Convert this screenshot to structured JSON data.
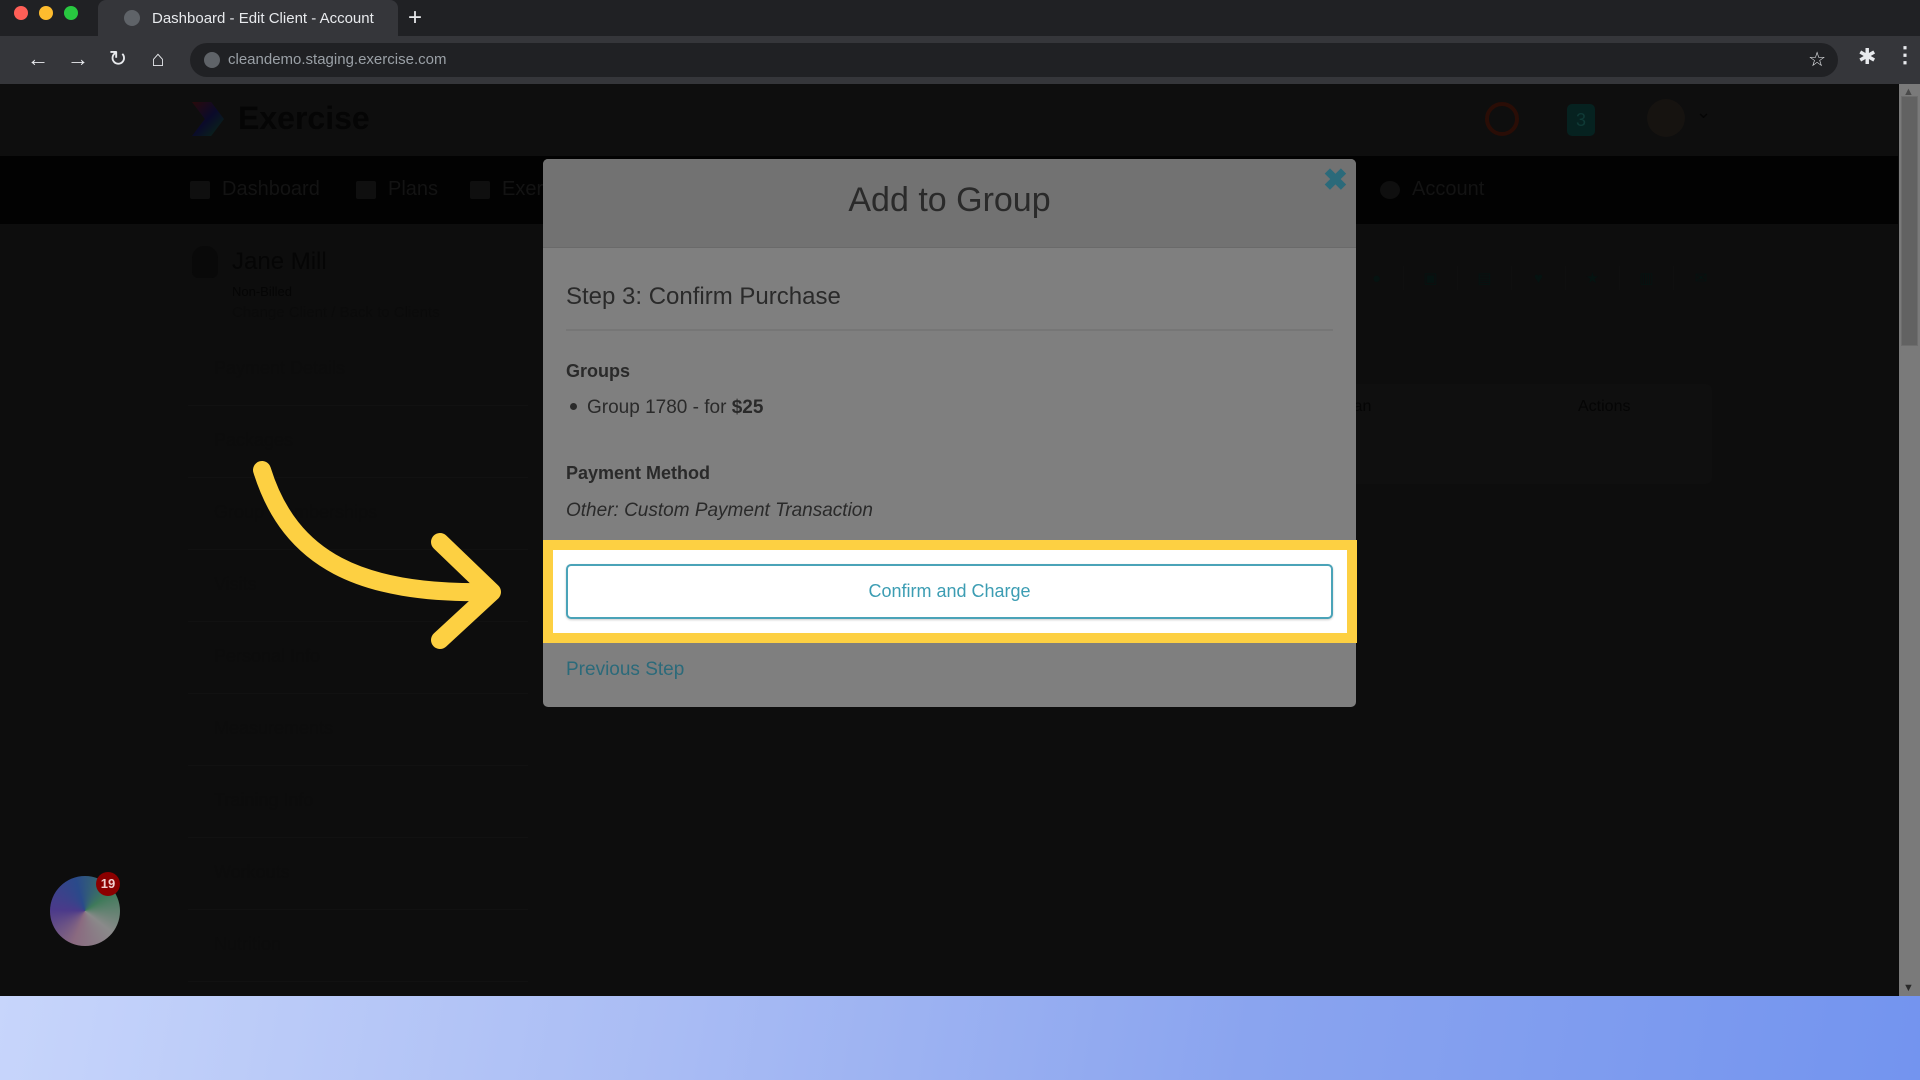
{
  "browser": {
    "tab_title": "Dashboard - Edit Client - Account",
    "new_tab_icon": "+",
    "url": "cleandemo.staging.exercise.com",
    "icons": {
      "back": "←",
      "forward": "→",
      "reload": "↻",
      "home": "⌂",
      "star": "☆",
      "extensions": "✱",
      "menu": "⋮"
    }
  },
  "app": {
    "logo_text": "Exercise",
    "header_badge": "3",
    "header_chevron": "⌄",
    "nav": [
      {
        "label": "Dashboard",
        "icon": "list-icon"
      },
      {
        "label": "Plans",
        "icon": "clipboard-icon"
      },
      {
        "label": "Exer",
        "icon": "dumbbell-icon"
      },
      {
        "label": "Account",
        "icon": "user-circle-icon"
      }
    ],
    "client": {
      "name": "Jane Mill",
      "status": "Non-Billed",
      "links": "Change Client / Back to Clients"
    },
    "side_menu": [
      "Payment Details",
      "Packages",
      "Group Memberships",
      "Visits",
      "Personal Info",
      "Measurements",
      "Training Info",
      "Workouts",
      "Nutrition"
    ],
    "icon_row": [
      "user-icon",
      "calendar-check-icon",
      "document-icon",
      "heartbeat-icon",
      "star-icon",
      "bar-chart-icon",
      "envelope-icon"
    ],
    "icon_row_glyphs": [
      "●",
      "▣",
      "▤",
      "♥",
      "★",
      "▥",
      "✉"
    ],
    "table_headers": {
      "plan": "lan",
      "actions": "Actions"
    }
  },
  "assistant": {
    "badge_count": "19"
  },
  "modal": {
    "title": "Add to Group",
    "close_icon": "✖",
    "step_title": "Step 3: Confirm Purchase",
    "groups_heading": "Groups",
    "group_item_text": "Group 1780 - for ",
    "group_item_price": "$25",
    "payment_heading": "Payment Method",
    "payment_value": "Other: Custom Payment Transaction",
    "confirm_label": "Confirm and Charge",
    "previous_label": "Previous Step"
  },
  "colors": {
    "highlight": "#fdd042",
    "accent": "#3c9db3",
    "badge": "#8b0000"
  },
  "scrollbar": {
    "up": "▲",
    "down": "▼"
  }
}
